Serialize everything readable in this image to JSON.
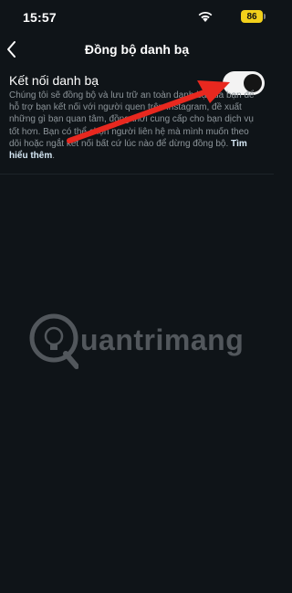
{
  "status_bar": {
    "time": "15:57",
    "battery_level": "86",
    "battery_color": "#f2d01b"
  },
  "header": {
    "back_icon": "chevron-left-icon",
    "title": "Đồng bộ danh bạ"
  },
  "contact_sync": {
    "label": "Kết nối danh bạ",
    "enabled": true,
    "description": "Chúng tôi sẽ đồng bộ và lưu trữ an toàn danh bạ của bạn để hỗ trợ bạn kết nối với người quen trên Instagram, đề xuất những gì bạn quan tâm, đồng thời cung cấp cho bạn dịch vụ tốt hơn. Bạn có thể chọn người liên hệ mà mình muốn theo dõi hoặc ngắt kết nối bất cứ lúc nào để dừng đồng bộ.",
    "learn_more": "Tìm hiểu thêm"
  },
  "watermark": {
    "text": "uantrimang"
  },
  "colors": {
    "background": "#0f1418",
    "annotation_arrow": "#e8281f",
    "link": "#d7e9f6"
  }
}
